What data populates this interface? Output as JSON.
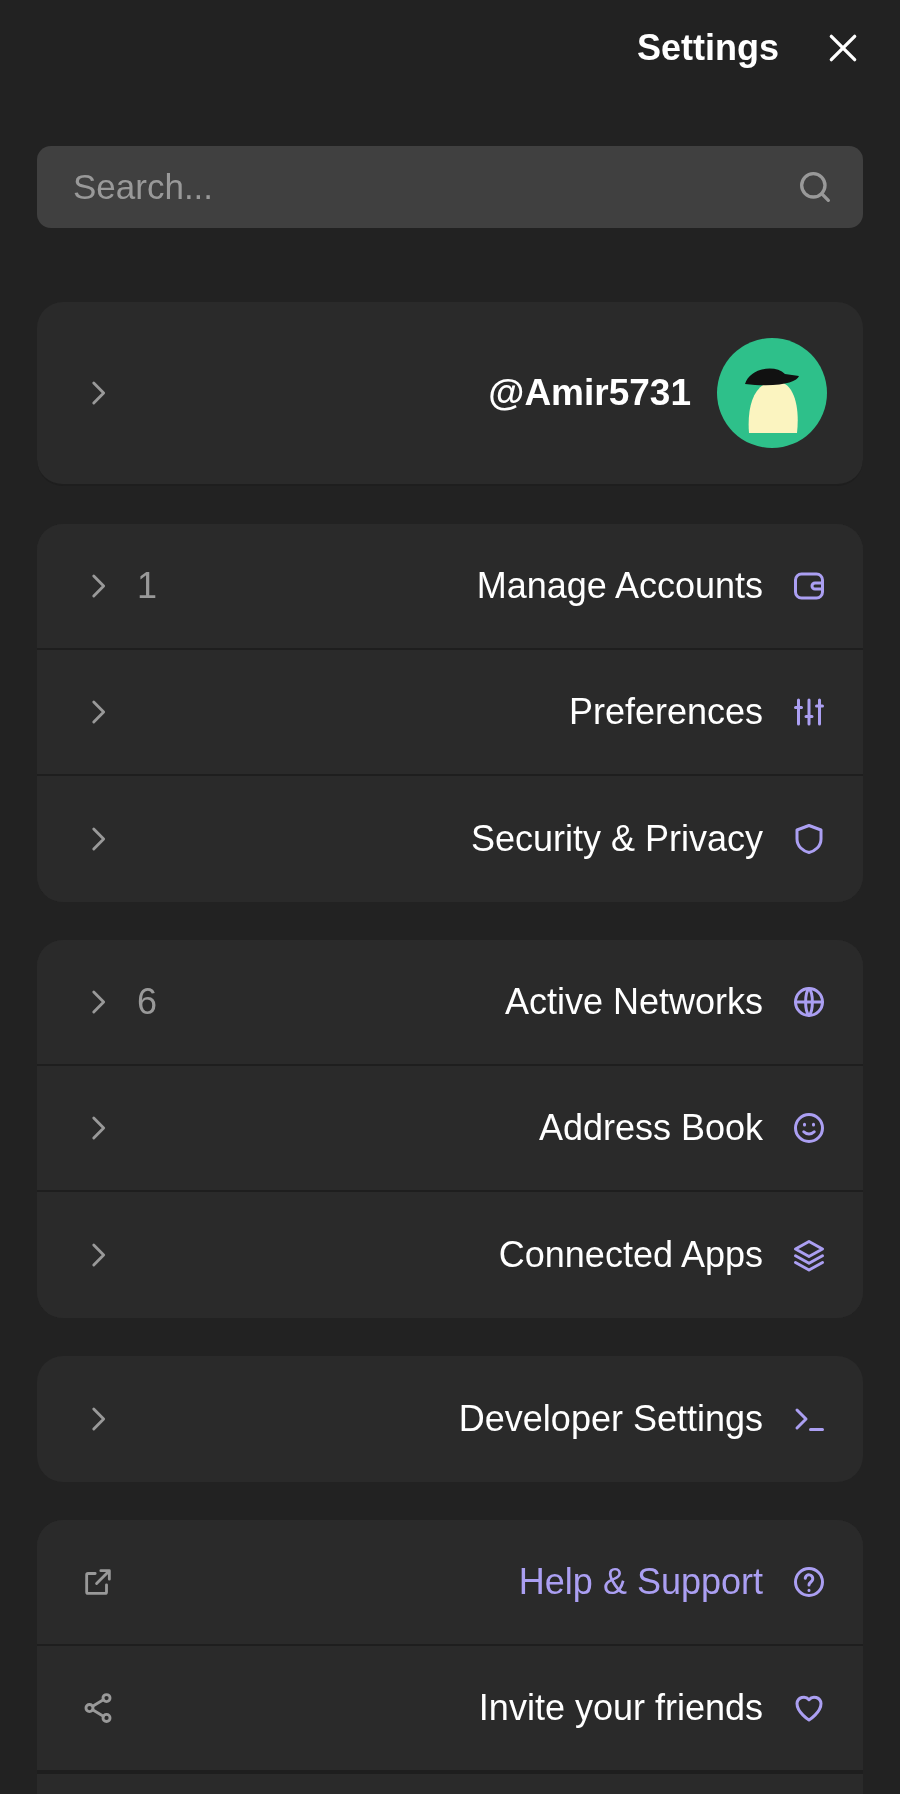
{
  "header": {
    "title": "Settings"
  },
  "search": {
    "placeholder": "Search..."
  },
  "profile": {
    "username": "@Amir5731"
  },
  "groups": [
    {
      "items": [
        {
          "kind": "nav",
          "label": "Manage Accounts",
          "count": "1"
        },
        {
          "kind": "nav",
          "label": "Preferences"
        },
        {
          "kind": "nav",
          "label": "Security & Privacy"
        }
      ]
    },
    {
      "items": [
        {
          "kind": "nav",
          "label": "Active Networks",
          "count": "6"
        },
        {
          "kind": "nav",
          "label": "Address Book"
        },
        {
          "kind": "nav",
          "label": "Connected Apps"
        }
      ]
    },
    {
      "items": [
        {
          "kind": "nav",
          "label": "Developer Settings"
        }
      ]
    },
    {
      "items": [
        {
          "kind": "link",
          "label": "Help & Support"
        },
        {
          "kind": "share",
          "label": "Invite your friends"
        }
      ]
    }
  ]
}
